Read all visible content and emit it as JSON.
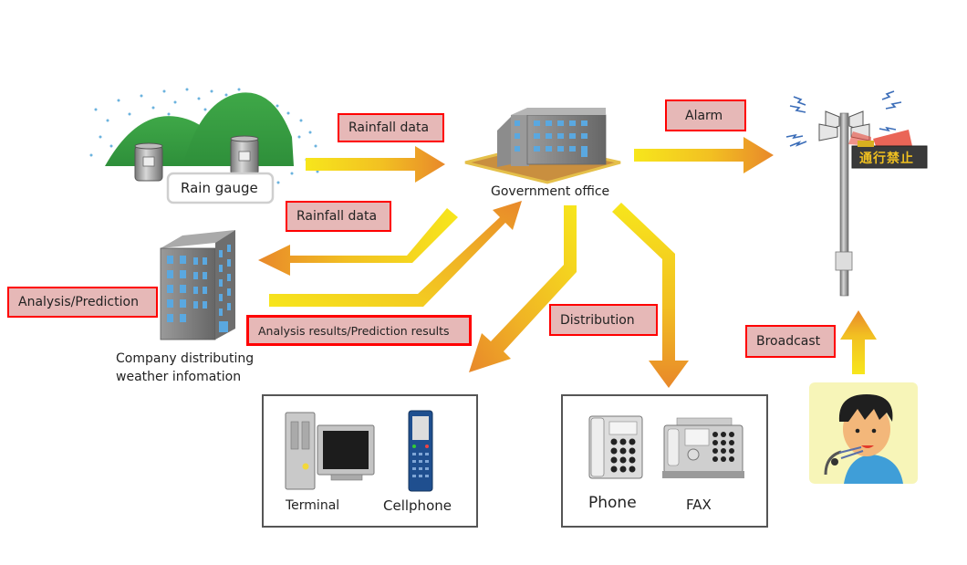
{
  "diagram": {
    "nodes": {
      "rain_gauge": {
        "label": "Rain gauge"
      },
      "government_office": {
        "label": "Government office"
      },
      "company": {
        "label_line1": "Company distributing",
        "label_line2": "weather infomation"
      },
      "terminal": {
        "label": "Terminal"
      },
      "cellphone": {
        "label": "Cellphone"
      },
      "phone": {
        "label": "Phone"
      },
      "fax": {
        "label": "FAX"
      },
      "siren_sign": {
        "sign_text": "通行禁止"
      }
    },
    "edge_labels": {
      "rainfall_data_1": "Rainfall data",
      "rainfall_data_2": "Rainfall data",
      "alarm": "Alarm",
      "analysis_prediction": "Analysis/Prediction",
      "analysis_results": "Analysis results/Prediction results",
      "distribution": "Distribution",
      "broadcast": "Broadcast"
    },
    "edges": [
      {
        "from": "rain_gauge",
        "to": "government_office",
        "label": "Rainfall data"
      },
      {
        "from": "government_office",
        "to": "company",
        "label": "Rainfall data"
      },
      {
        "from": "company",
        "to": "government_office",
        "label": "Analysis results/Prediction results"
      },
      {
        "from": "government_office",
        "to": "siren_sign",
        "label": "Alarm"
      },
      {
        "from": "government_office",
        "to": "terminal_cellphone",
        "label": "Distribution"
      },
      {
        "from": "government_office",
        "to": "phone_fax",
        "label": "Distribution"
      },
      {
        "from": "announcer",
        "to": "siren_sign",
        "label": "Broadcast"
      }
    ],
    "colors": {
      "tag_fill": "#e6b8b7",
      "tag_border": "#ff0000",
      "arrow_start": "#f5e21a",
      "arrow_end": "#e88a2a"
    }
  }
}
